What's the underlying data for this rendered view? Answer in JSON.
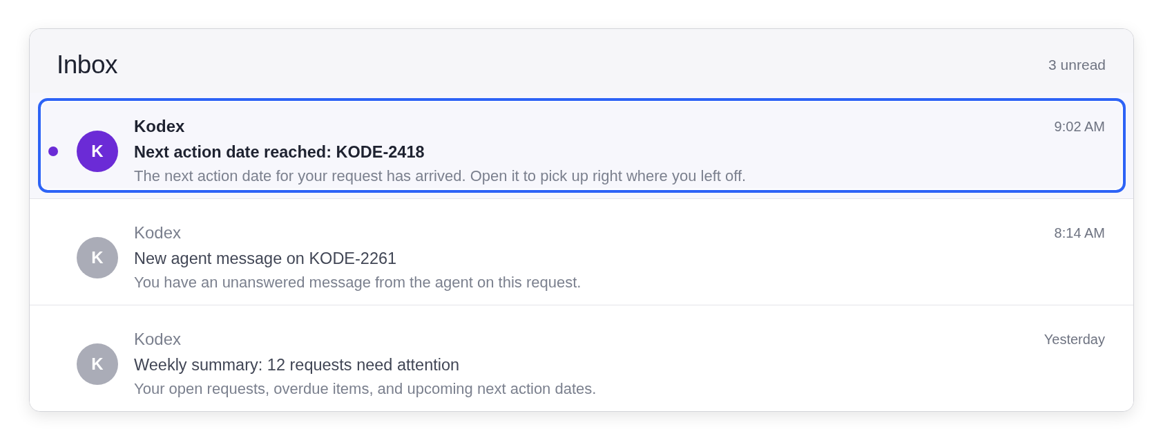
{
  "header": {
    "title": "Inbox",
    "unread_count": "3 unread"
  },
  "messages": [
    {
      "sender": "Kodex",
      "avatar_letter": "K",
      "subject": "Next action date reached: KODE-2418",
      "preview": "The next action date for your request has arrived. Open it to pick up right where you left off.",
      "time": "9:02 AM",
      "unread": true,
      "selected": true
    },
    {
      "sender": "Kodex",
      "avatar_letter": "K",
      "subject": "New agent message on KODE-2261",
      "preview": "You have an unanswered message from the agent on this request.",
      "time": "8:14 AM",
      "unread": false,
      "selected": false
    },
    {
      "sender": "Kodex",
      "avatar_letter": "K",
      "subject": "Weekly summary: 12 requests need attention",
      "preview": "Your open requests, overdue items, and upcoming next action dates.",
      "time": "Yesterday",
      "unread": false,
      "selected": false
    }
  ]
}
